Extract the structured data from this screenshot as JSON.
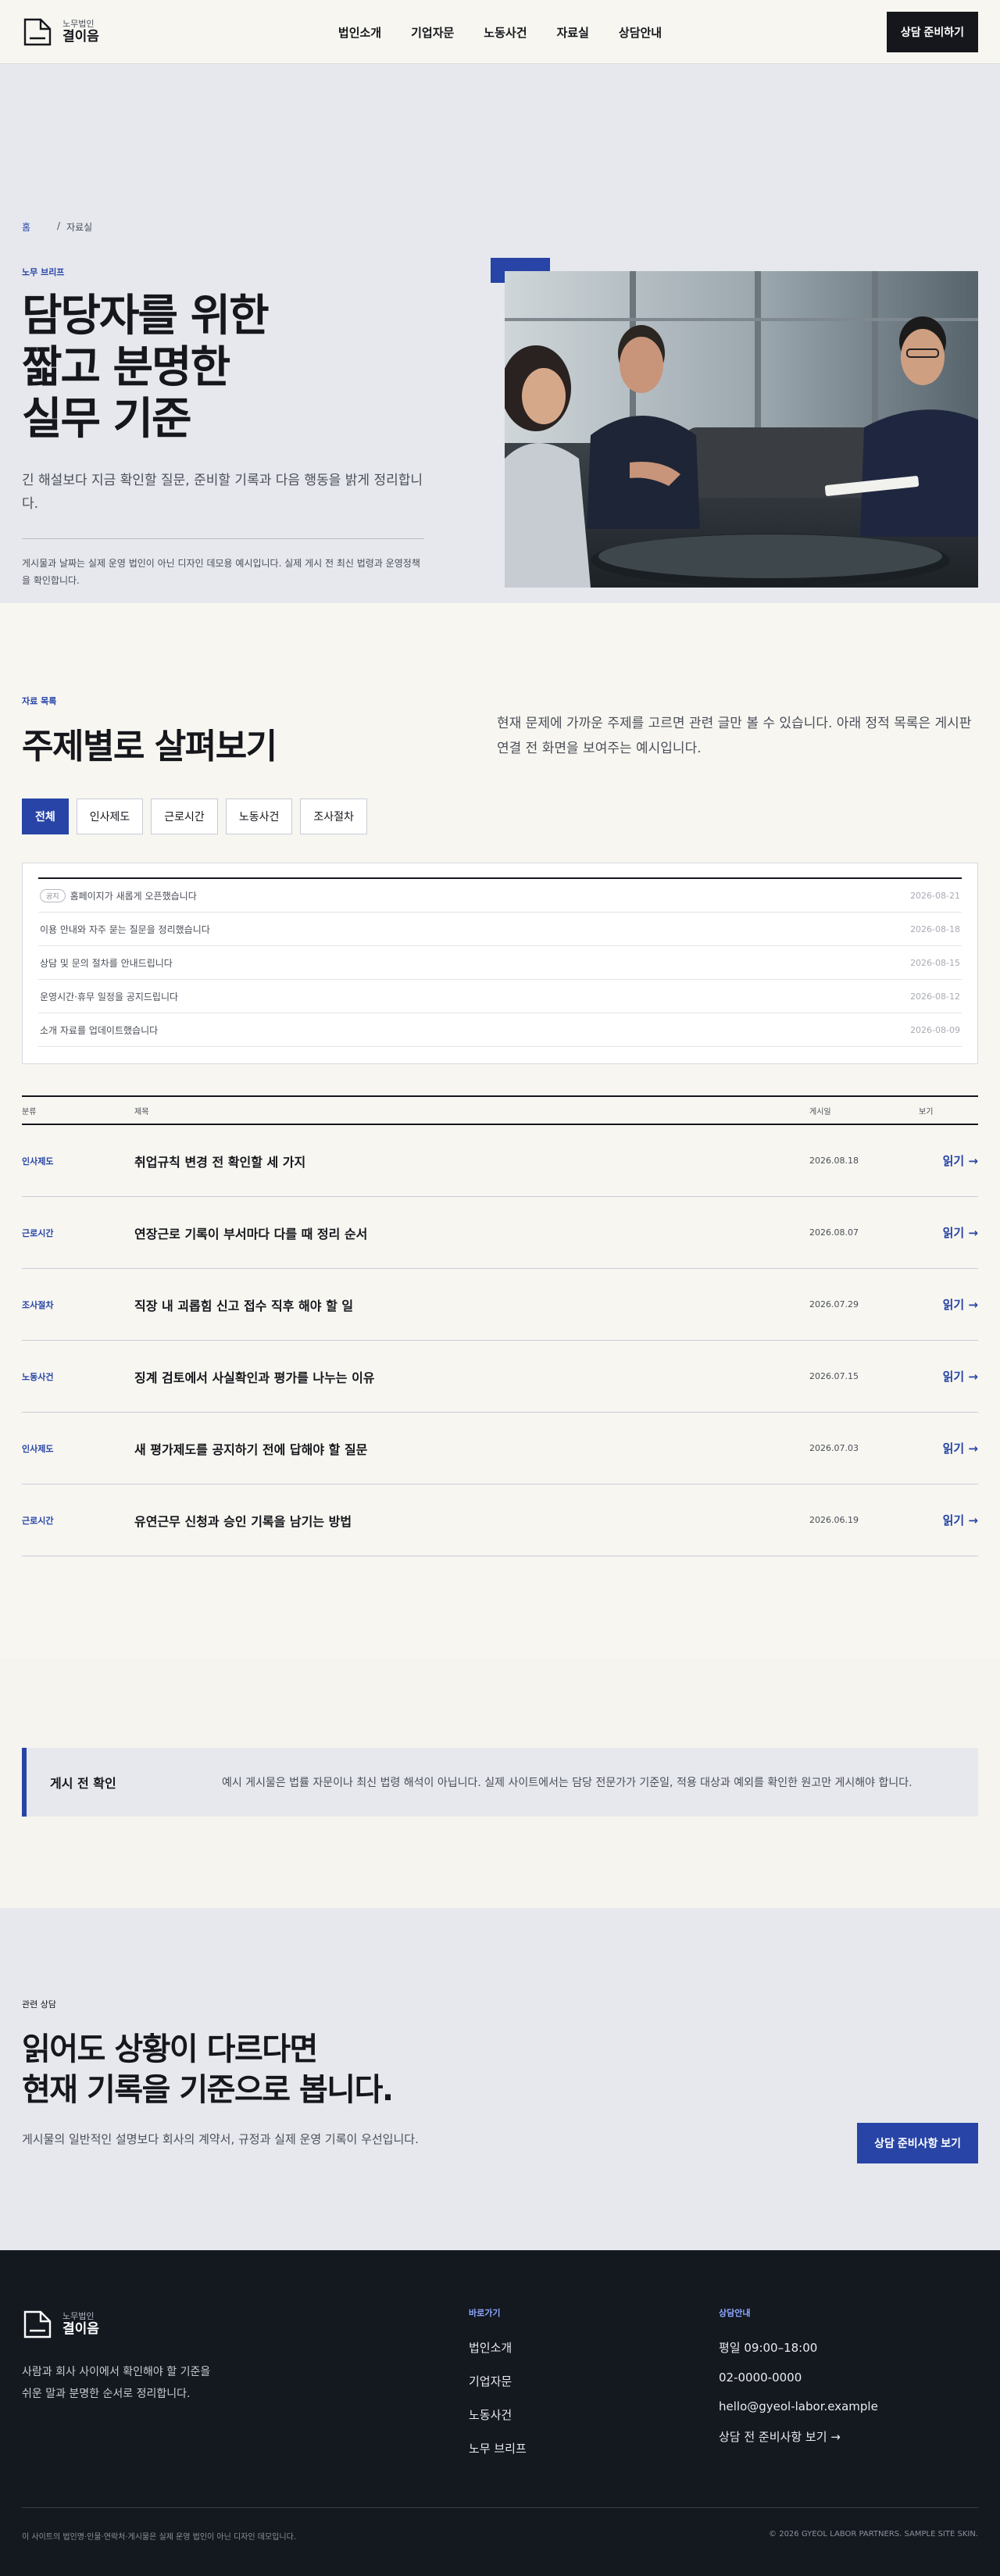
{
  "brand": {
    "sub": "노무법인",
    "name": "결이음"
  },
  "nav": {
    "items": [
      "법인소개",
      "기업자문",
      "노동사건",
      "자료실",
      "상담안내"
    ],
    "cta": "상담 준비하기"
  },
  "hero": {
    "breadcrumb_home": "홈",
    "breadcrumb_sep": "/",
    "breadcrumb_current": "자료실",
    "eyebrow": "노무 브리프",
    "title": "담당자를 위한\n짧고 분명한\n실무 기준",
    "lead": "긴 해설보다 지금 확인할 질문, 준비할 기록과 다음 행동을 밝게 정리합니다.",
    "note": "게시물과 날짜는 실제 운영 법인이 아닌 디자인 데모용 예시입니다. 실제 게시 전 최신 법령과 운영정책을 확인합니다."
  },
  "topics": {
    "eyebrow": "자료 목록",
    "title": "주제별로 살펴보기",
    "desc": "현재 문제에 가까운 주제를 고르면 관련 글만 볼 수 있습니다. 아래 정적 목록은 게시판 연결 전 화면을 보여주는 예시입니다.",
    "filters": [
      "전체",
      "인사제도",
      "근로시간",
      "노동사건",
      "조사절차"
    ],
    "notices": [
      {
        "badge": "공지",
        "title": "홈페이지가 새롭게 오픈했습니다",
        "date": "2026-08-21"
      },
      {
        "badge": "",
        "title": "이용 안내와 자주 묻는 질문을 정리했습니다",
        "date": "2026-08-18"
      },
      {
        "badge": "",
        "title": "상담 및 문의 절차를 안내드립니다",
        "date": "2026-08-15"
      },
      {
        "badge": "",
        "title": "운영시간·휴무 일정을 공지드립니다",
        "date": "2026-08-12"
      },
      {
        "badge": "",
        "title": "소개 자료를 업데이트했습니다",
        "date": "2026-08-09"
      }
    ],
    "table_head": {
      "cat": "분류",
      "title": "제목",
      "date": "게시일",
      "view": "보기"
    },
    "posts": [
      {
        "cat": "인사제도",
        "title": "취업규칙 변경 전 확인할 세 가지",
        "date": "2026.08.18",
        "view": "읽기 →"
      },
      {
        "cat": "근로시간",
        "title": "연장근로 기록이 부서마다 다를 때 정리 순서",
        "date": "2026.08.07",
        "view": "읽기 →"
      },
      {
        "cat": "조사절차",
        "title": "직장 내 괴롭힘 신고 접수 직후 해야 할 일",
        "date": "2026.07.29",
        "view": "읽기 →"
      },
      {
        "cat": "노동사건",
        "title": "징계 검토에서 사실확인과 평가를 나누는 이유",
        "date": "2026.07.15",
        "view": "읽기 →"
      },
      {
        "cat": "인사제도",
        "title": "새 평가제도를 공지하기 전에 답해야 할 질문",
        "date": "2026.07.03",
        "view": "읽기 →"
      },
      {
        "cat": "근로시간",
        "title": "유연근무 신청과 승인 기록을 남기는 방법",
        "date": "2026.06.19",
        "view": "읽기 →"
      }
    ]
  },
  "prepost": {
    "title": "게시 전 확인",
    "text": "예시 게시물은 법률 자문이나 최신 법령 해석이 아닙니다. 실제 사이트에서는 담당 전문가가 기준일, 적용 대상과 예외를 확인한 원고만 게시해야 합니다."
  },
  "consult": {
    "eyebrow": "관련 상담",
    "title": "읽어도 상황이 다르다면\n현재 기록을 기준으로 봅니다.",
    "desc": "게시물의 일반적인 설명보다 회사의 계약서, 규정과 실제 운영 기록이 우선입니다.",
    "button": "상담 준비사항 보기"
  },
  "footer": {
    "desc": "사람과 회사 사이에서 확인해야 할 기준을\n쉬운 말과 분명한 순서로 정리합니다.",
    "links_title": "바로가기",
    "links": [
      "법인소개",
      "기업자문",
      "노동사건",
      "노무 브리프"
    ],
    "info_title": "상담안내",
    "hours": "평일 09:00–18:00",
    "phone": "02-0000-0000",
    "email": "hello@gyeol-labor.example",
    "prep_link": "상담 전 준비사항 보기 →",
    "bottom_left": "이 사이트의 법인명·인물·연락처·게시물은 실제 운영 법인이 아닌 디자인 데모입니다.",
    "bottom_right": "© 2026 GYEOL LABOR PARTNERS. SAMPLE SITE SKIN."
  }
}
